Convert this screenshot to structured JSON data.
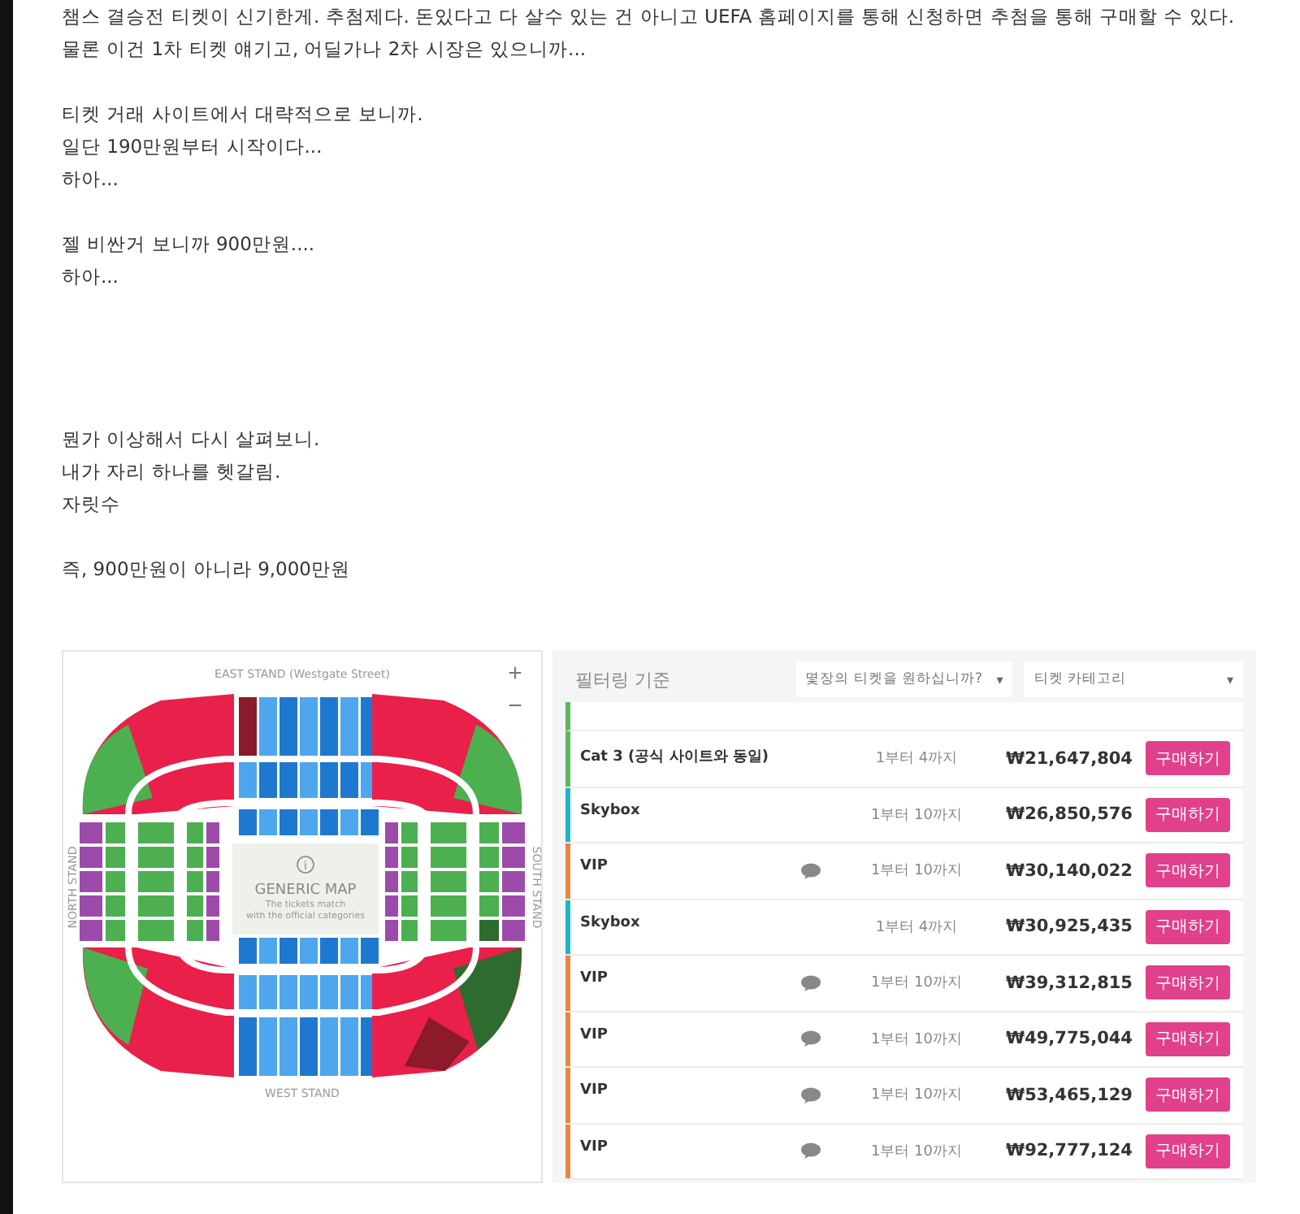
{
  "post": {
    "paragraphs": [
      [
        "챔스 결승전 티켓이 신기한게. 추첨제다. 돈있다고 다 살수 있는 건 아니고 UEFA 홈페이지를 통해 신청하면 추첨을 통해 구매할 수 있다.",
        "물론 이건 1차 티켓 얘기고, 어딜가나 2차 시장은 있으니까..."
      ],
      [
        "티켓 거래 사이트에서 대략적으로 보니까.",
        "일단 190만원부터 시작이다...",
        "하아..."
      ],
      [
        "젤 비싼거 보니까 900만원....",
        "하아..."
      ],
      [
        "뭔가 이상해서 다시 살펴보니.",
        "내가 자리 하나를 헷갈림.",
        "자릿수"
      ],
      [
        "즉, 900만원이 아니라 9,000만원"
      ]
    ]
  },
  "map": {
    "east_stand": "EAST STAND (Westgate Street)",
    "west_stand": "WEST STAND",
    "north_stand": "NORTH STAND",
    "south_stand": "SOUTH STAND",
    "info_mark": "i",
    "title": "GENERIC MAP",
    "subtitle_lines": [
      "The tickets match",
      "with the official categories"
    ],
    "zoom_buttons": [
      "+",
      "−"
    ]
  },
  "listing": {
    "filter_label": "필터링 기준",
    "dropdowns": [
      {
        "placeholder": "몇장의 티켓을 원하십니까?",
        "caret": "▾"
      },
      {
        "placeholder": "티켓 카테고리",
        "caret": "▾"
      }
    ],
    "rows": [
      {
        "category": "Cat 3 (공식 사이트와 동일)",
        "color": "#5cb85c",
        "note": false,
        "quantity": "1부터 4까지",
        "price": "₩21,647,804",
        "button": "구매하기"
      },
      {
        "category": "Skybox",
        "color": "#1fb6c4",
        "note": false,
        "quantity": "1부터 10까지",
        "price": "₩26,850,576",
        "button": "구매하기"
      },
      {
        "category": "VIP",
        "color": "#e8873a",
        "note": true,
        "quantity": "1부터 10까지",
        "price": "₩30,140,022",
        "button": "구매하기"
      },
      {
        "category": "Skybox",
        "color": "#1fb6c4",
        "note": false,
        "quantity": "1부터 4까지",
        "price": "₩30,925,435",
        "button": "구매하기"
      },
      {
        "category": "VIP",
        "color": "#e8873a",
        "note": true,
        "quantity": "1부터 10까지",
        "price": "₩39,312,815",
        "button": "구매하기"
      },
      {
        "category": "VIP",
        "color": "#e8873a",
        "note": true,
        "quantity": "1부터 10까지",
        "price": "₩49,775,044",
        "button": "구매하기"
      },
      {
        "category": "VIP",
        "color": "#e8873a",
        "note": true,
        "quantity": "1부터 10까지",
        "price": "₩53,465,129",
        "button": "구매하기"
      },
      {
        "category": "VIP",
        "color": "#e8873a",
        "note": true,
        "quantity": "1부터 10까지",
        "price": "₩92,777,124",
        "button": "구매하기"
      }
    ]
  }
}
